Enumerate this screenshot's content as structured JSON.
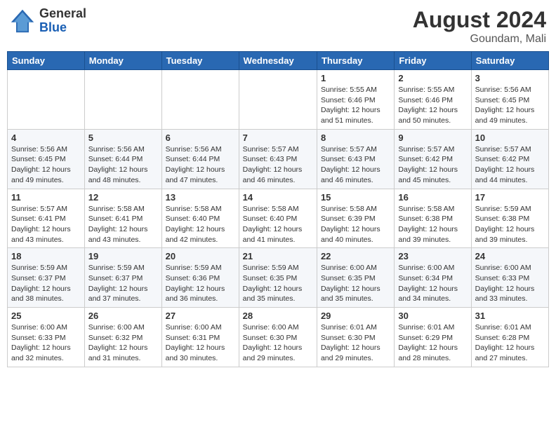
{
  "logo": {
    "general": "General",
    "blue": "Blue"
  },
  "title": {
    "month_year": "August 2024",
    "location": "Goundam, Mali"
  },
  "days_of_week": [
    "Sunday",
    "Monday",
    "Tuesday",
    "Wednesday",
    "Thursday",
    "Friday",
    "Saturday"
  ],
  "weeks": [
    [
      {
        "day": "",
        "content": ""
      },
      {
        "day": "",
        "content": ""
      },
      {
        "day": "",
        "content": ""
      },
      {
        "day": "",
        "content": ""
      },
      {
        "day": "1",
        "content": "Sunrise: 5:55 AM\nSunset: 6:46 PM\nDaylight: 12 hours\nand 51 minutes."
      },
      {
        "day": "2",
        "content": "Sunrise: 5:55 AM\nSunset: 6:46 PM\nDaylight: 12 hours\nand 50 minutes."
      },
      {
        "day": "3",
        "content": "Sunrise: 5:56 AM\nSunset: 6:45 PM\nDaylight: 12 hours\nand 49 minutes."
      }
    ],
    [
      {
        "day": "4",
        "content": "Sunrise: 5:56 AM\nSunset: 6:45 PM\nDaylight: 12 hours\nand 49 minutes."
      },
      {
        "day": "5",
        "content": "Sunrise: 5:56 AM\nSunset: 6:44 PM\nDaylight: 12 hours\nand 48 minutes."
      },
      {
        "day": "6",
        "content": "Sunrise: 5:56 AM\nSunset: 6:44 PM\nDaylight: 12 hours\nand 47 minutes."
      },
      {
        "day": "7",
        "content": "Sunrise: 5:57 AM\nSunset: 6:43 PM\nDaylight: 12 hours\nand 46 minutes."
      },
      {
        "day": "8",
        "content": "Sunrise: 5:57 AM\nSunset: 6:43 PM\nDaylight: 12 hours\nand 46 minutes."
      },
      {
        "day": "9",
        "content": "Sunrise: 5:57 AM\nSunset: 6:42 PM\nDaylight: 12 hours\nand 45 minutes."
      },
      {
        "day": "10",
        "content": "Sunrise: 5:57 AM\nSunset: 6:42 PM\nDaylight: 12 hours\nand 44 minutes."
      }
    ],
    [
      {
        "day": "11",
        "content": "Sunrise: 5:57 AM\nSunset: 6:41 PM\nDaylight: 12 hours\nand 43 minutes."
      },
      {
        "day": "12",
        "content": "Sunrise: 5:58 AM\nSunset: 6:41 PM\nDaylight: 12 hours\nand 43 minutes."
      },
      {
        "day": "13",
        "content": "Sunrise: 5:58 AM\nSunset: 6:40 PM\nDaylight: 12 hours\nand 42 minutes."
      },
      {
        "day": "14",
        "content": "Sunrise: 5:58 AM\nSunset: 6:40 PM\nDaylight: 12 hours\nand 41 minutes."
      },
      {
        "day": "15",
        "content": "Sunrise: 5:58 AM\nSunset: 6:39 PM\nDaylight: 12 hours\nand 40 minutes."
      },
      {
        "day": "16",
        "content": "Sunrise: 5:58 AM\nSunset: 6:38 PM\nDaylight: 12 hours\nand 39 minutes."
      },
      {
        "day": "17",
        "content": "Sunrise: 5:59 AM\nSunset: 6:38 PM\nDaylight: 12 hours\nand 39 minutes."
      }
    ],
    [
      {
        "day": "18",
        "content": "Sunrise: 5:59 AM\nSunset: 6:37 PM\nDaylight: 12 hours\nand 38 minutes."
      },
      {
        "day": "19",
        "content": "Sunrise: 5:59 AM\nSunset: 6:37 PM\nDaylight: 12 hours\nand 37 minutes."
      },
      {
        "day": "20",
        "content": "Sunrise: 5:59 AM\nSunset: 6:36 PM\nDaylight: 12 hours\nand 36 minutes."
      },
      {
        "day": "21",
        "content": "Sunrise: 5:59 AM\nSunset: 6:35 PM\nDaylight: 12 hours\nand 35 minutes."
      },
      {
        "day": "22",
        "content": "Sunrise: 6:00 AM\nSunset: 6:35 PM\nDaylight: 12 hours\nand 35 minutes."
      },
      {
        "day": "23",
        "content": "Sunrise: 6:00 AM\nSunset: 6:34 PM\nDaylight: 12 hours\nand 34 minutes."
      },
      {
        "day": "24",
        "content": "Sunrise: 6:00 AM\nSunset: 6:33 PM\nDaylight: 12 hours\nand 33 minutes."
      }
    ],
    [
      {
        "day": "25",
        "content": "Sunrise: 6:00 AM\nSunset: 6:33 PM\nDaylight: 12 hours\nand 32 minutes."
      },
      {
        "day": "26",
        "content": "Sunrise: 6:00 AM\nSunset: 6:32 PM\nDaylight: 12 hours\nand 31 minutes."
      },
      {
        "day": "27",
        "content": "Sunrise: 6:00 AM\nSunset: 6:31 PM\nDaylight: 12 hours\nand 30 minutes."
      },
      {
        "day": "28",
        "content": "Sunrise: 6:00 AM\nSunset: 6:30 PM\nDaylight: 12 hours\nand 29 minutes."
      },
      {
        "day": "29",
        "content": "Sunrise: 6:01 AM\nSunset: 6:30 PM\nDaylight: 12 hours\nand 29 minutes."
      },
      {
        "day": "30",
        "content": "Sunrise: 6:01 AM\nSunset: 6:29 PM\nDaylight: 12 hours\nand 28 minutes."
      },
      {
        "day": "31",
        "content": "Sunrise: 6:01 AM\nSunset: 6:28 PM\nDaylight: 12 hours\nand 27 minutes."
      }
    ]
  ]
}
